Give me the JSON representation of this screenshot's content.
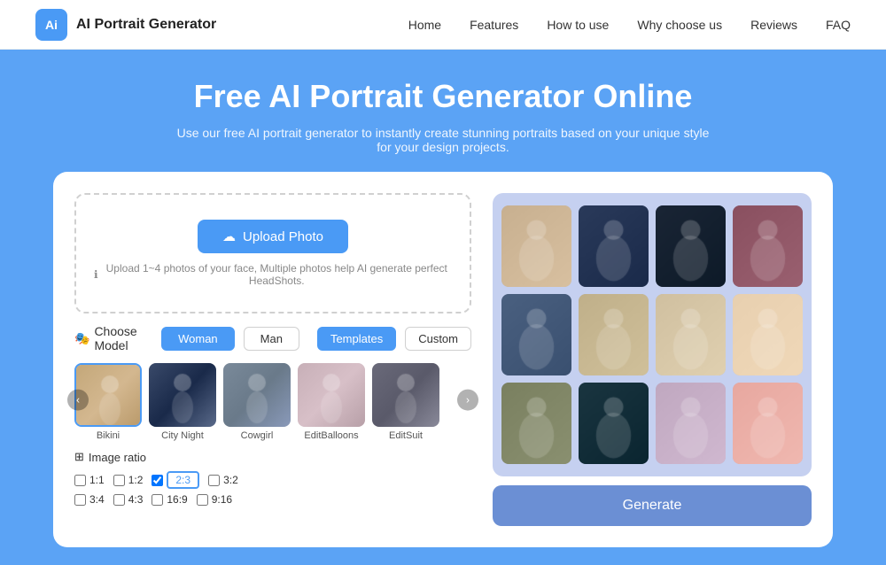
{
  "header": {
    "logo_text": "AI Portrait Generator",
    "logo_icon": "Ai",
    "nav": [
      {
        "label": "Home",
        "active": false
      },
      {
        "label": "Features",
        "active": false
      },
      {
        "label": "How to use",
        "active": false
      },
      {
        "label": "Why choose us",
        "active": false
      },
      {
        "label": "Reviews",
        "active": false
      },
      {
        "label": "FAQ",
        "active": false
      }
    ]
  },
  "hero": {
    "title": "Free AI Portrait Generator Online",
    "subtitle": "Use our free AI portrait generator to instantly create stunning portraits based on your unique style for your design projects."
  },
  "upload": {
    "button_label": "Upload Photo",
    "hint": "Upload 1~4 photos of your face, Multiple photos help AI generate perfect HeadShots."
  },
  "model": {
    "label": "Choose Model",
    "options": [
      {
        "label": "Woman",
        "active": true
      },
      {
        "label": "Man",
        "active": false
      }
    ]
  },
  "templates": {
    "options": [
      {
        "label": "Templates",
        "active": true
      },
      {
        "label": "Custom",
        "active": false
      }
    ]
  },
  "thumbs": [
    {
      "label": "Bikini",
      "selected": true,
      "color": "#c4a87a"
    },
    {
      "label": "City Night",
      "selected": false,
      "color": "#6a7a8a"
    },
    {
      "label": "Cowgirl",
      "selected": false,
      "color": "#8a9ab0"
    },
    {
      "label": "EditBalloons",
      "selected": false,
      "color": "#d0b0b8"
    },
    {
      "label": "EditSuit",
      "selected": false,
      "color": "#7a7a7a"
    }
  ],
  "ratio": {
    "label": "Image ratio",
    "options": [
      [
        "1:1",
        "1:2",
        "2:3",
        "3:2"
      ],
      [
        "3:4",
        "4:3",
        "16:9",
        "9:16"
      ]
    ],
    "selected": "2:3"
  },
  "generate": {
    "button_label": "Generate"
  },
  "gallery": {
    "images": [
      {
        "color": "#c8b090"
      },
      {
        "color": "#2a3a5a"
      },
      {
        "color": "#1a2a3a"
      },
      {
        "color": "#8a5060"
      },
      {
        "color": "#3a5070"
      },
      {
        "color": "#c0b08a"
      },
      {
        "color": "#d0c0a0"
      },
      {
        "color": "#e8d0b0"
      },
      {
        "color": "#6a8060"
      },
      {
        "color": "#1a3a4a"
      },
      {
        "color": "#c0a8c0"
      },
      {
        "color": "#e8a8a0"
      }
    ]
  }
}
